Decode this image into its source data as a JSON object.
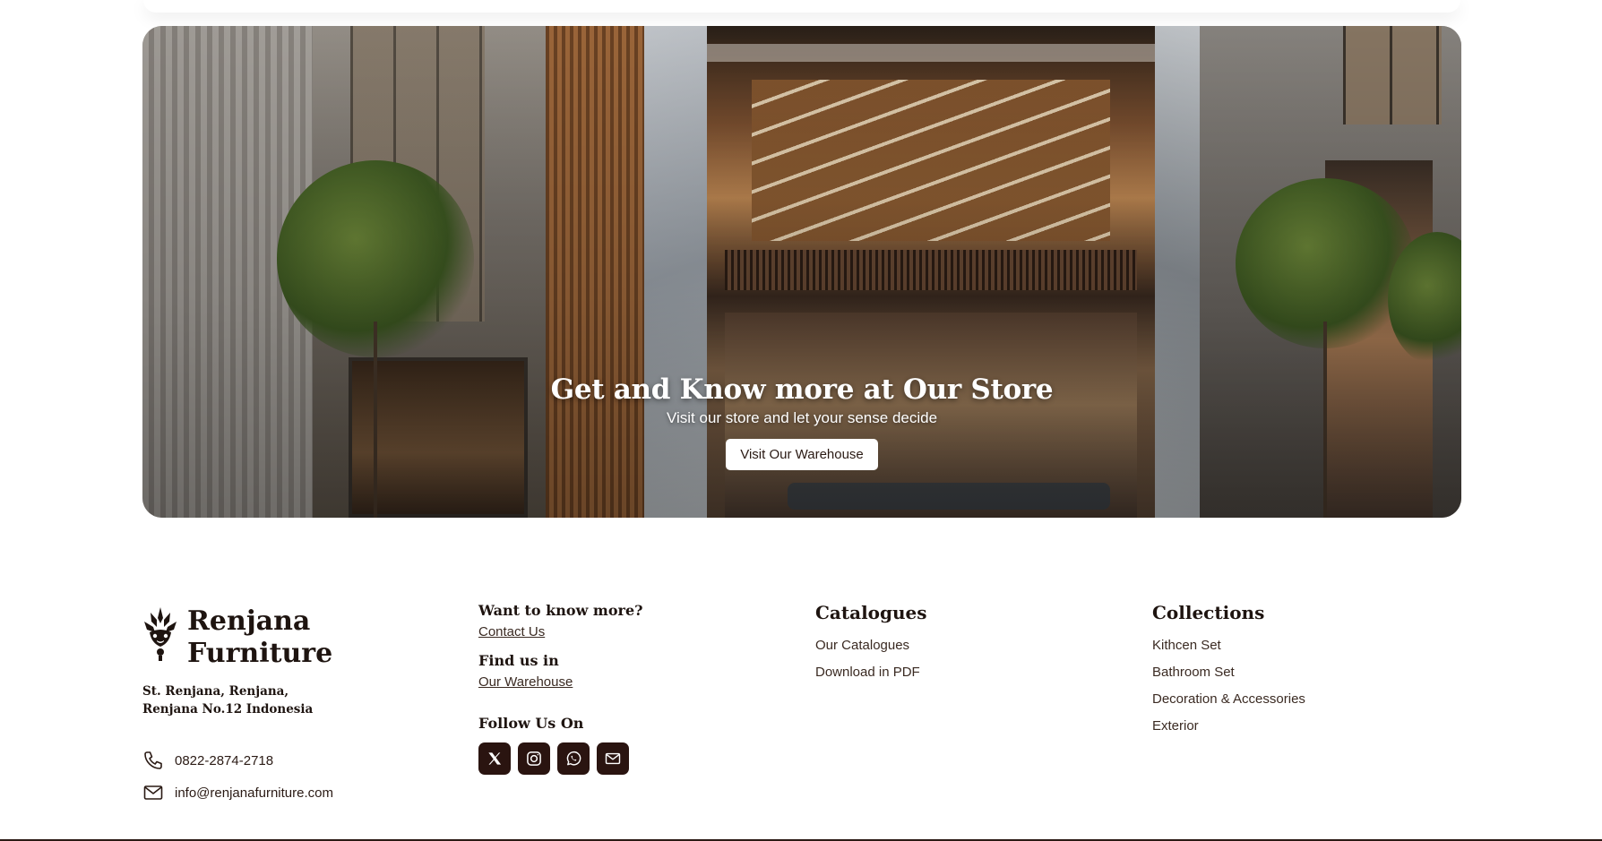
{
  "hero": {
    "title": "Get and Know more at Our Store",
    "subtitle": "Visit our store and let your sense decide",
    "button_label": "Visit Our Warehouse"
  },
  "footer": {
    "brand": {
      "name_line1": "Renjana",
      "name_line2": "Furniture",
      "address": "St. Renjana, Renjana, Renjana No.12 Indonesia",
      "phone": "0822-2874-2718",
      "email": "info@renjanafurniture.com"
    },
    "more": {
      "heading": "Want to know more?",
      "contact_link": "Contact Us",
      "find_heading": "Find us in",
      "warehouse_link": "Our Warehouse",
      "follow_heading": "Follow Us On",
      "socials": [
        "x-icon",
        "instagram-icon",
        "whatsapp-icon",
        "mail-icon"
      ]
    },
    "catalogues": {
      "heading": "Catalogues",
      "links": [
        "Our Catalogues",
        "Download in PDF"
      ]
    },
    "collections": {
      "heading": "Collections",
      "links": [
        "Kithcen Set",
        "Bathroom Set",
        "Decoration & Accessories",
        "Exterior"
      ]
    }
  },
  "colors": {
    "brand_dark": "#2a1410",
    "text": "#2a1a14",
    "background": "#ffffff"
  }
}
